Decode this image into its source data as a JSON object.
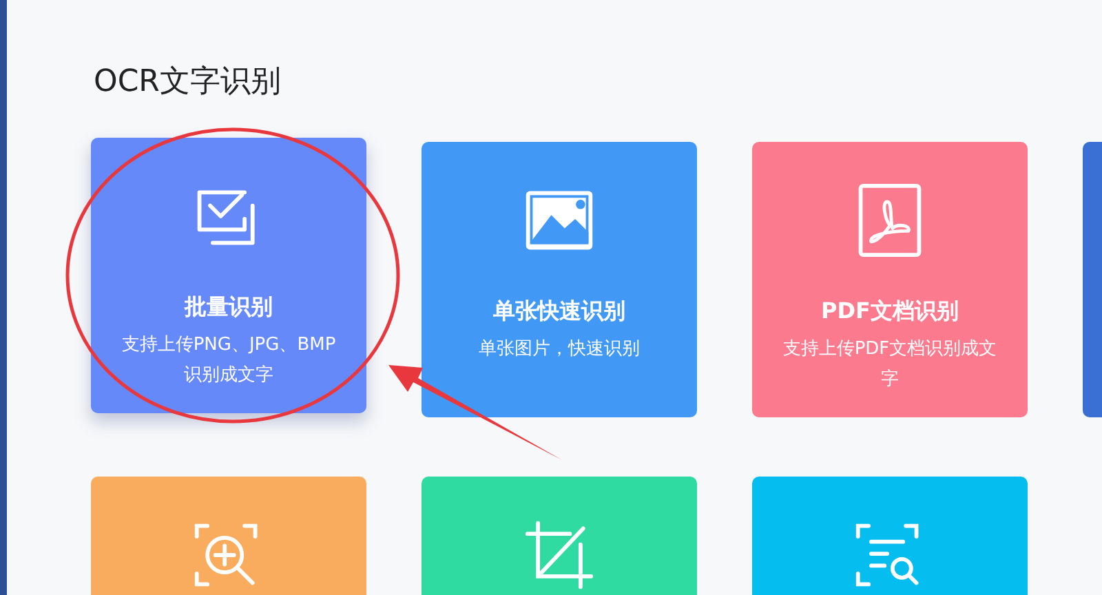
{
  "section_title": "OCR文字识别",
  "cards": [
    {
      "kind": "batch",
      "title": "批量识别",
      "description": "支持上传PNG、JPG、BMP识别成文字",
      "color": "#6689fa",
      "hovered": true,
      "circled": true
    },
    {
      "kind": "image",
      "title": "单张快速识别",
      "description": "单张图片，快速识别",
      "color": "#4299f5",
      "hovered": false,
      "circled": false
    },
    {
      "kind": "pdf",
      "title": "PDF文档识别",
      "description": "支持上传PDF文档识别成文字",
      "color": "#fc7a8e",
      "hovered": false,
      "circled": false
    },
    {
      "kind": "blank",
      "color": "#3a70d4",
      "hovered": false,
      "circled": false
    },
    {
      "kind": "zoom",
      "color": "#f9ab5e",
      "hovered": false,
      "circled": false
    },
    {
      "kind": "crop",
      "color": "#2fdba0",
      "hovered": false,
      "circled": false
    },
    {
      "kind": "scan",
      "color": "#05bdee",
      "hovered": false,
      "circled": false
    }
  ]
}
